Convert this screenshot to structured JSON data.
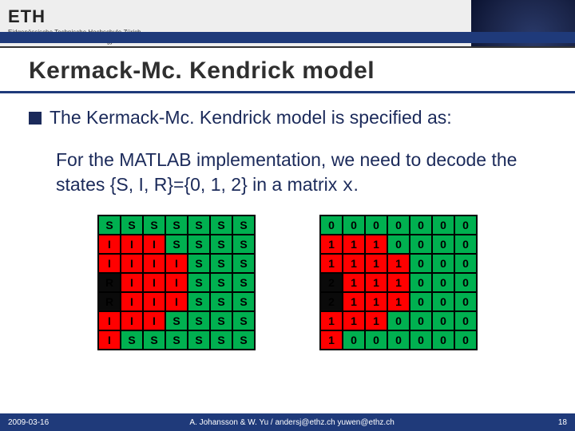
{
  "header": {
    "logo_text": "ETH",
    "sub1": "Eidgenössische Technische Hochschule Zürich",
    "sub2": "Swiss Federal Institute of Technology Zurich"
  },
  "title": "Kermack-Mc. Kendrick model",
  "bullet1": "The Kermack-Mc. Kendrick model is specified as:",
  "para1_a": "For the MATLAB implementation, we need to decode the states {S, I, R}={0, 1, 2} in a matrix ",
  "para1_b": "x",
  "para1_c": ".",
  "state_colors": {
    "S": "c-S",
    "I": "c-I",
    "R": "c-R",
    "0": "c-S",
    "1": "c-I",
    "2": "c-R"
  },
  "left_grid": [
    [
      "S",
      "S",
      "S",
      "S",
      "S",
      "S",
      "S"
    ],
    [
      "I",
      "I",
      "I",
      "S",
      "S",
      "S",
      "S"
    ],
    [
      "I",
      "I",
      "I",
      "I",
      "S",
      "S",
      "S"
    ],
    [
      "R",
      "I",
      "I",
      "I",
      "S",
      "S",
      "S"
    ],
    [
      "R",
      "I",
      "I",
      "I",
      "S",
      "S",
      "S"
    ],
    [
      "I",
      "I",
      "I",
      "S",
      "S",
      "S",
      "S"
    ],
    [
      "I",
      "S",
      "S",
      "S",
      "S",
      "S",
      "S"
    ]
  ],
  "right_grid": [
    [
      "0",
      "0",
      "0",
      "0",
      "0",
      "0",
      "0"
    ],
    [
      "1",
      "1",
      "1",
      "0",
      "0",
      "0",
      "0"
    ],
    [
      "1",
      "1",
      "1",
      "1",
      "0",
      "0",
      "0"
    ],
    [
      "2",
      "1",
      "1",
      "1",
      "0",
      "0",
      "0"
    ],
    [
      "2",
      "1",
      "1",
      "1",
      "0",
      "0",
      "0"
    ],
    [
      "1",
      "1",
      "1",
      "0",
      "0",
      "0",
      "0"
    ],
    [
      "1",
      "0",
      "0",
      "0",
      "0",
      "0",
      "0"
    ]
  ],
  "footer": {
    "date": "2009-03-16",
    "credits": "A. Johansson & W. Yu / andersj@ethz.ch yuwen@ethz.ch",
    "page": "18"
  }
}
